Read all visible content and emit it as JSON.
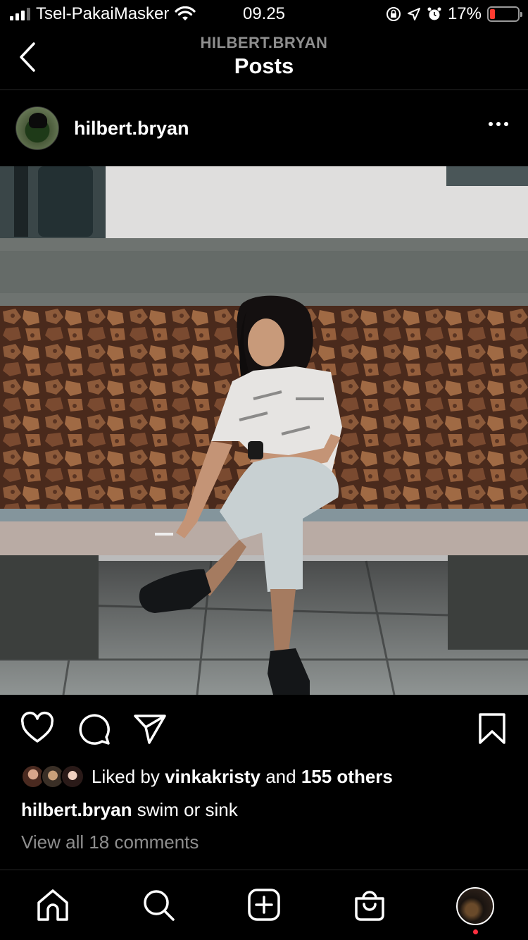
{
  "status_bar": {
    "carrier": "Tsel-PakaiMasker",
    "time": "09.25",
    "battery": "17%"
  },
  "header": {
    "username_caps": "HILBERT.BRYAN",
    "title": "Posts"
  },
  "post": {
    "username": "hilbert.bryan",
    "liked_by_prefix": "Liked by",
    "liked_by_user": "vinkakristy",
    "liked_by_and": "and",
    "liked_by_others": "155 others",
    "caption_user": "hilbert.bryan",
    "caption_text": "swim or sink",
    "comments_link": "View all 18 comments"
  },
  "icons": {
    "back": "chevron-left-icon",
    "more": "more-horizontal-icon",
    "like": "heart-icon",
    "comment": "comment-icon",
    "share": "paper-plane-icon",
    "save": "bookmark-icon",
    "home": "home-icon",
    "search": "search-icon",
    "create": "plus-square-icon",
    "shop": "shopping-bag-icon"
  },
  "colors": {
    "background": "#000000",
    "secondary_text": "#8e8e8e",
    "notification": "#ff3040",
    "battery_low": "#ff3b30"
  }
}
